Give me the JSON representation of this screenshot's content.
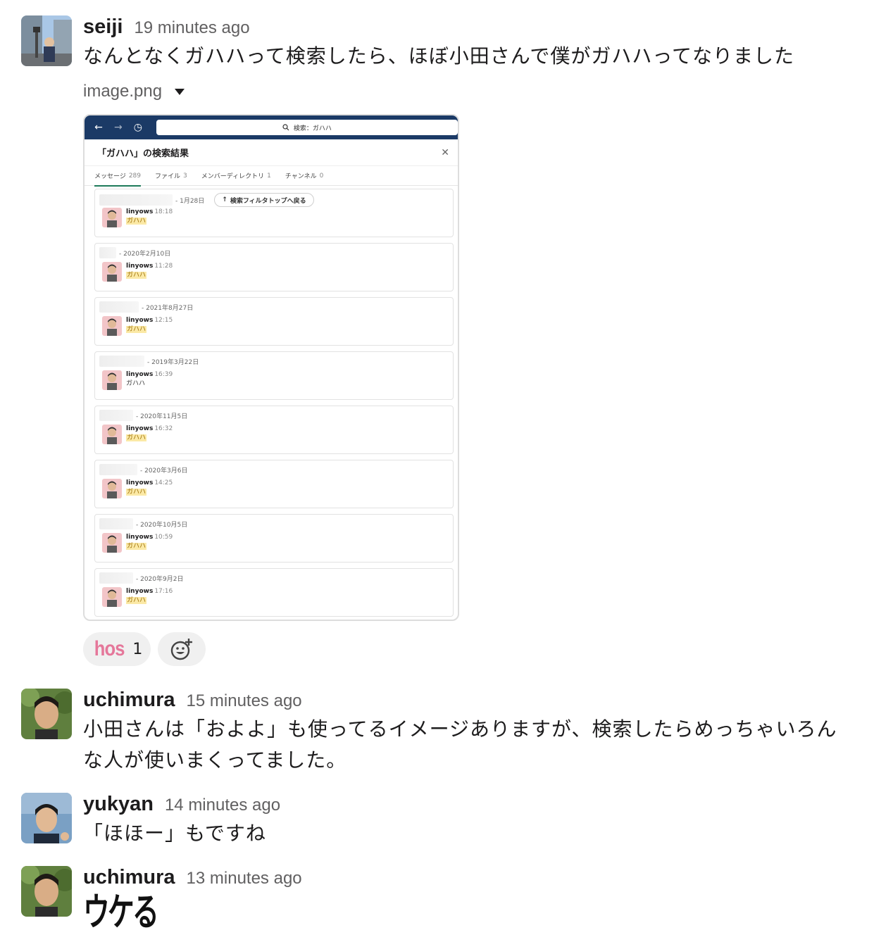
{
  "messages": [
    {
      "user": "seiji",
      "time": "19 minutes ago",
      "text": "なんとなくガハハって検索したら、ほぼ小田さんで僕がガハハってなりました",
      "attachment": {
        "file_name": "image.png",
        "screenshot": {
          "search_text": "検索：ガハハ",
          "title": "「ガハハ」の検索結果",
          "tabs": [
            {
              "label": "メッセージ",
              "count": "289"
            },
            {
              "label": "ファイル",
              "count": "3"
            },
            {
              "label": "メンバーディレクトリ",
              "count": "1"
            },
            {
              "label": "チャンネル",
              "count": "0"
            }
          ],
          "back_to_top": "検索フィルタトップへ戻る",
          "results": [
            {
              "date": "- 1月28日",
              "user": "linyows",
              "time": "18:18",
              "text": "ガハハ",
              "highlight": true
            },
            {
              "date": "- 2020年2月10日",
              "user": "linyows",
              "time": "11:28",
              "text": "ガハハ",
              "highlight": true
            },
            {
              "date": "- 2021年8月27日",
              "user": "linyows",
              "time": "12:15",
              "text": "ガハハ",
              "highlight": true
            },
            {
              "date": "- 2019年3月22日",
              "user": "linyows",
              "time": "16:39",
              "text": "ガハハ",
              "highlight": false
            },
            {
              "date": "- 2020年11月5日",
              "user": "linyows",
              "time": "16:32",
              "text": "ガハハ",
              "highlight": true
            },
            {
              "date": "- 2020年3月6日",
              "user": "linyows",
              "time": "14:25",
              "text": "ガハハ",
              "highlight": true
            },
            {
              "date": "- 2020年10月5日",
              "user": "linyows",
              "time": "10:59",
              "text": "ガハハ",
              "highlight": true
            },
            {
              "date": "- 2020年9月2日",
              "user": "linyows",
              "time": "17:16",
              "text": "ガハハ",
              "highlight": true
            }
          ]
        }
      },
      "reactions": [
        {
          "emoji": "hos",
          "count": "1"
        }
      ]
    },
    {
      "user": "uchimura",
      "time": "15 minutes ago",
      "text_line1": "小田さんは「およよ」も使ってるイメージありますが、検索したらめっちゃいろん",
      "text_line2": "な人が使いまくってました。"
    },
    {
      "user": "yukyan",
      "time": "14 minutes ago",
      "text": "「ほほー」もですね"
    },
    {
      "user": "uchimura",
      "time": "13 minutes ago",
      "emoji_text": "ウケる"
    }
  ],
  "colors": {
    "accent_tab": "#1d7a5a",
    "screenshot_topbar": "#1b3a66",
    "highlight": "#fbe9a6",
    "reaction_emoji": "#e5779a"
  }
}
